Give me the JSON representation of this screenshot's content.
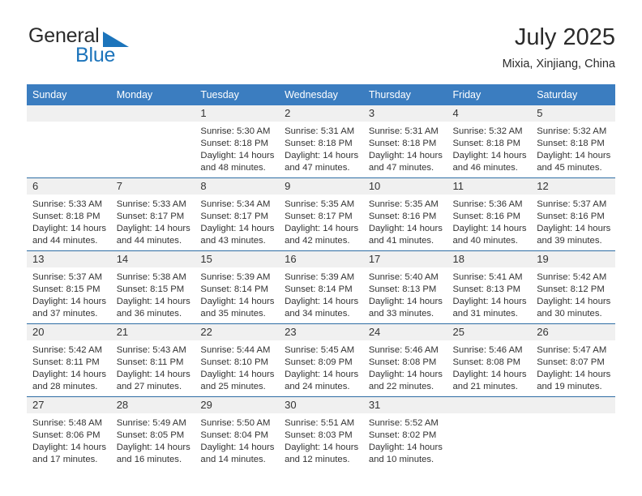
{
  "brand": {
    "name_top": "General",
    "name_bottom": "Blue",
    "triangle_color": "#1c74bb"
  },
  "header": {
    "month_title": "July 2025",
    "location": "Mixia, Xinjiang, China"
  },
  "theme": {
    "header_blue": "#3b7dc0",
    "row_divider": "#2e6da4",
    "daynum_band": "#f0f0f0",
    "text": "#333333"
  },
  "calendar": {
    "weekday_headers": [
      "Sunday",
      "Monday",
      "Tuesday",
      "Wednesday",
      "Thursday",
      "Friday",
      "Saturday"
    ],
    "weeks": [
      [
        {
          "day": "",
          "sunrise": "",
          "sunset": "",
          "daylight_1": "",
          "daylight_2": ""
        },
        {
          "day": "",
          "sunrise": "",
          "sunset": "",
          "daylight_1": "",
          "daylight_2": ""
        },
        {
          "day": "1",
          "sunrise": "Sunrise: 5:30 AM",
          "sunset": "Sunset: 8:18 PM",
          "daylight_1": "Daylight: 14 hours",
          "daylight_2": "and 48 minutes."
        },
        {
          "day": "2",
          "sunrise": "Sunrise: 5:31 AM",
          "sunset": "Sunset: 8:18 PM",
          "daylight_1": "Daylight: 14 hours",
          "daylight_2": "and 47 minutes."
        },
        {
          "day": "3",
          "sunrise": "Sunrise: 5:31 AM",
          "sunset": "Sunset: 8:18 PM",
          "daylight_1": "Daylight: 14 hours",
          "daylight_2": "and 47 minutes."
        },
        {
          "day": "4",
          "sunrise": "Sunrise: 5:32 AM",
          "sunset": "Sunset: 8:18 PM",
          "daylight_1": "Daylight: 14 hours",
          "daylight_2": "and 46 minutes."
        },
        {
          "day": "5",
          "sunrise": "Sunrise: 5:32 AM",
          "sunset": "Sunset: 8:18 PM",
          "daylight_1": "Daylight: 14 hours",
          "daylight_2": "and 45 minutes."
        }
      ],
      [
        {
          "day": "6",
          "sunrise": "Sunrise: 5:33 AM",
          "sunset": "Sunset: 8:18 PM",
          "daylight_1": "Daylight: 14 hours",
          "daylight_2": "and 44 minutes."
        },
        {
          "day": "7",
          "sunrise": "Sunrise: 5:33 AM",
          "sunset": "Sunset: 8:17 PM",
          "daylight_1": "Daylight: 14 hours",
          "daylight_2": "and 44 minutes."
        },
        {
          "day": "8",
          "sunrise": "Sunrise: 5:34 AM",
          "sunset": "Sunset: 8:17 PM",
          "daylight_1": "Daylight: 14 hours",
          "daylight_2": "and 43 minutes."
        },
        {
          "day": "9",
          "sunrise": "Sunrise: 5:35 AM",
          "sunset": "Sunset: 8:17 PM",
          "daylight_1": "Daylight: 14 hours",
          "daylight_2": "and 42 minutes."
        },
        {
          "day": "10",
          "sunrise": "Sunrise: 5:35 AM",
          "sunset": "Sunset: 8:16 PM",
          "daylight_1": "Daylight: 14 hours",
          "daylight_2": "and 41 minutes."
        },
        {
          "day": "11",
          "sunrise": "Sunrise: 5:36 AM",
          "sunset": "Sunset: 8:16 PM",
          "daylight_1": "Daylight: 14 hours",
          "daylight_2": "and 40 minutes."
        },
        {
          "day": "12",
          "sunrise": "Sunrise: 5:37 AM",
          "sunset": "Sunset: 8:16 PM",
          "daylight_1": "Daylight: 14 hours",
          "daylight_2": "and 39 minutes."
        }
      ],
      [
        {
          "day": "13",
          "sunrise": "Sunrise: 5:37 AM",
          "sunset": "Sunset: 8:15 PM",
          "daylight_1": "Daylight: 14 hours",
          "daylight_2": "and 37 minutes."
        },
        {
          "day": "14",
          "sunrise": "Sunrise: 5:38 AM",
          "sunset": "Sunset: 8:15 PM",
          "daylight_1": "Daylight: 14 hours",
          "daylight_2": "and 36 minutes."
        },
        {
          "day": "15",
          "sunrise": "Sunrise: 5:39 AM",
          "sunset": "Sunset: 8:14 PM",
          "daylight_1": "Daylight: 14 hours",
          "daylight_2": "and 35 minutes."
        },
        {
          "day": "16",
          "sunrise": "Sunrise: 5:39 AM",
          "sunset": "Sunset: 8:14 PM",
          "daylight_1": "Daylight: 14 hours",
          "daylight_2": "and 34 minutes."
        },
        {
          "day": "17",
          "sunrise": "Sunrise: 5:40 AM",
          "sunset": "Sunset: 8:13 PM",
          "daylight_1": "Daylight: 14 hours",
          "daylight_2": "and 33 minutes."
        },
        {
          "day": "18",
          "sunrise": "Sunrise: 5:41 AM",
          "sunset": "Sunset: 8:13 PM",
          "daylight_1": "Daylight: 14 hours",
          "daylight_2": "and 31 minutes."
        },
        {
          "day": "19",
          "sunrise": "Sunrise: 5:42 AM",
          "sunset": "Sunset: 8:12 PM",
          "daylight_1": "Daylight: 14 hours",
          "daylight_2": "and 30 minutes."
        }
      ],
      [
        {
          "day": "20",
          "sunrise": "Sunrise: 5:42 AM",
          "sunset": "Sunset: 8:11 PM",
          "daylight_1": "Daylight: 14 hours",
          "daylight_2": "and 28 minutes."
        },
        {
          "day": "21",
          "sunrise": "Sunrise: 5:43 AM",
          "sunset": "Sunset: 8:11 PM",
          "daylight_1": "Daylight: 14 hours",
          "daylight_2": "and 27 minutes."
        },
        {
          "day": "22",
          "sunrise": "Sunrise: 5:44 AM",
          "sunset": "Sunset: 8:10 PM",
          "daylight_1": "Daylight: 14 hours",
          "daylight_2": "and 25 minutes."
        },
        {
          "day": "23",
          "sunrise": "Sunrise: 5:45 AM",
          "sunset": "Sunset: 8:09 PM",
          "daylight_1": "Daylight: 14 hours",
          "daylight_2": "and 24 minutes."
        },
        {
          "day": "24",
          "sunrise": "Sunrise: 5:46 AM",
          "sunset": "Sunset: 8:08 PM",
          "daylight_1": "Daylight: 14 hours",
          "daylight_2": "and 22 minutes."
        },
        {
          "day": "25",
          "sunrise": "Sunrise: 5:46 AM",
          "sunset": "Sunset: 8:08 PM",
          "daylight_1": "Daylight: 14 hours",
          "daylight_2": "and 21 minutes."
        },
        {
          "day": "26",
          "sunrise": "Sunrise: 5:47 AM",
          "sunset": "Sunset: 8:07 PM",
          "daylight_1": "Daylight: 14 hours",
          "daylight_2": "and 19 minutes."
        }
      ],
      [
        {
          "day": "27",
          "sunrise": "Sunrise: 5:48 AM",
          "sunset": "Sunset: 8:06 PM",
          "daylight_1": "Daylight: 14 hours",
          "daylight_2": "and 17 minutes."
        },
        {
          "day": "28",
          "sunrise": "Sunrise: 5:49 AM",
          "sunset": "Sunset: 8:05 PM",
          "daylight_1": "Daylight: 14 hours",
          "daylight_2": "and 16 minutes."
        },
        {
          "day": "29",
          "sunrise": "Sunrise: 5:50 AM",
          "sunset": "Sunset: 8:04 PM",
          "daylight_1": "Daylight: 14 hours",
          "daylight_2": "and 14 minutes."
        },
        {
          "day": "30",
          "sunrise": "Sunrise: 5:51 AM",
          "sunset": "Sunset: 8:03 PM",
          "daylight_1": "Daylight: 14 hours",
          "daylight_2": "and 12 minutes."
        },
        {
          "day": "31",
          "sunrise": "Sunrise: 5:52 AM",
          "sunset": "Sunset: 8:02 PM",
          "daylight_1": "Daylight: 14 hours",
          "daylight_2": "and 10 minutes."
        },
        {
          "day": "",
          "sunrise": "",
          "sunset": "",
          "daylight_1": "",
          "daylight_2": ""
        },
        {
          "day": "",
          "sunrise": "",
          "sunset": "",
          "daylight_1": "",
          "daylight_2": ""
        }
      ]
    ]
  }
}
